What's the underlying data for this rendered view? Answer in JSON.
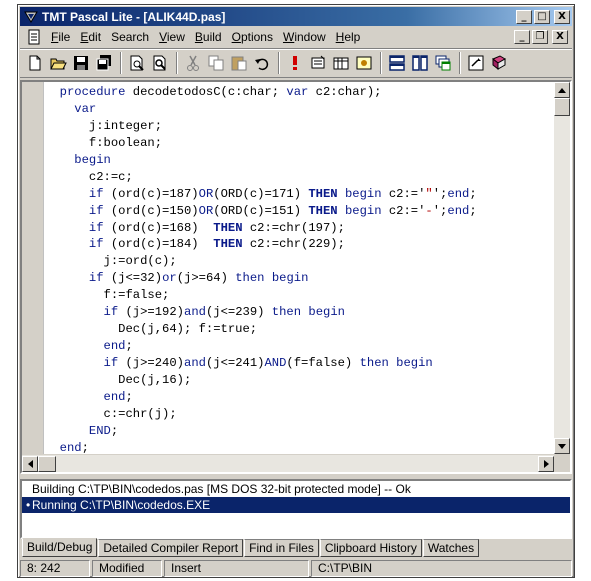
{
  "window": {
    "title": "TMT Pascal Lite - [ALIK44D.pas]",
    "controls": {
      "minimize": "_",
      "maximize": "□",
      "close": "X"
    }
  },
  "menubar": {
    "items": [
      {
        "label": "File",
        "accel": "F",
        "rest": "ile"
      },
      {
        "label": "Edit",
        "accel": "E",
        "rest": "dit"
      },
      {
        "label": "Search",
        "accel": "",
        "rest": "Search"
      },
      {
        "label": "View",
        "accel": "V",
        "rest": "iew"
      },
      {
        "label": "Build",
        "accel": "B",
        "rest": "uild"
      },
      {
        "label": "Options",
        "accel": "O",
        "rest": "ptions"
      },
      {
        "label": "Window",
        "accel": "W",
        "rest": "indow"
      },
      {
        "label": "Help",
        "accel": "H",
        "rest": "elp"
      }
    ],
    "mdi_controls": {
      "minimize": "_",
      "restore": "❐",
      "close": "X"
    }
  },
  "toolbar": {
    "buttons": [
      "new-file-icon",
      "open-folder-icon",
      "save-icon",
      "save-all-icon",
      "print-preview-icon",
      "find-icon",
      "cut-icon",
      "copy-icon",
      "paste-icon",
      "undo-icon",
      "run-icon",
      "compile-icon",
      "build-icon",
      "debug-icon",
      "tile-horizontal-icon",
      "tile-vertical-icon",
      "cascade-icon",
      "help-icon",
      "book-icon"
    ]
  },
  "editor": {
    "lines": [
      [
        [
          "kwp",
          "procedure"
        ],
        [
          "t",
          " decodetodosC(c:char; "
        ],
        [
          "kwp",
          "var"
        ],
        [
          "t",
          " c2:char);"
        ]
      ],
      [
        [
          "t",
          "  "
        ],
        [
          "kwp",
          "var"
        ]
      ],
      [
        [
          "t",
          "    j:integer;"
        ]
      ],
      [
        [
          "t",
          "    f:boolean;"
        ]
      ],
      [
        [
          "t",
          "  "
        ],
        [
          "kwp",
          "begin"
        ]
      ],
      [
        [
          "t",
          "    c2:=c;"
        ]
      ],
      [
        [
          "t",
          "    "
        ],
        [
          "kwp",
          "if"
        ],
        [
          "t",
          " (ord(c)=187)"
        ],
        [
          "kwp",
          "OR"
        ],
        [
          "t",
          "(ORD(c)=171) "
        ],
        [
          "kw",
          "THEN"
        ],
        [
          "t",
          " "
        ],
        [
          "kwp",
          "begin"
        ],
        [
          "t",
          " c2:='"
        ],
        [
          "str",
          "\""
        ],
        [
          "t",
          "';"
        ],
        [
          "kwp",
          "end"
        ],
        [
          "t",
          ";"
        ]
      ],
      [
        [
          "t",
          "    "
        ],
        [
          "kwp",
          "if"
        ],
        [
          "t",
          " (ord(c)=150)"
        ],
        [
          "kwp",
          "OR"
        ],
        [
          "t",
          "(ORD(c)=151) "
        ],
        [
          "kw",
          "THEN"
        ],
        [
          "t",
          " "
        ],
        [
          "kwp",
          "begin"
        ],
        [
          "t",
          " c2:='"
        ],
        [
          "str",
          "-"
        ],
        [
          "t",
          "';"
        ],
        [
          "kwp",
          "end"
        ],
        [
          "t",
          ";"
        ]
      ],
      [
        [
          "t",
          "    "
        ],
        [
          "kwp",
          "if"
        ],
        [
          "t",
          " (ord(c)=168)  "
        ],
        [
          "kw",
          "THEN"
        ],
        [
          "t",
          " c2:=chr(197);"
        ]
      ],
      [
        [
          "t",
          "    "
        ],
        [
          "kwp",
          "if"
        ],
        [
          "t",
          " (ord(c)=184)  "
        ],
        [
          "kw",
          "THEN"
        ],
        [
          "t",
          " c2:=chr(229);"
        ]
      ],
      [
        [
          "t",
          "      j:=ord(c);"
        ]
      ],
      [
        [
          "t",
          "    "
        ],
        [
          "kwp",
          "if"
        ],
        [
          "t",
          " (j<=32)"
        ],
        [
          "kwp",
          "or"
        ],
        [
          "t",
          "(j>=64) "
        ],
        [
          "kwp",
          "then"
        ],
        [
          "t",
          " "
        ],
        [
          "kwp",
          "begin"
        ]
      ],
      [
        [
          "t",
          "      f:=false;"
        ]
      ],
      [
        [
          "t",
          "      "
        ],
        [
          "kwp",
          "if"
        ],
        [
          "t",
          " (j>=192)"
        ],
        [
          "kwp",
          "and"
        ],
        [
          "t",
          "(j<=239) "
        ],
        [
          "kwp",
          "then"
        ],
        [
          "t",
          " "
        ],
        [
          "kwp",
          "begin"
        ]
      ],
      [
        [
          "t",
          "        Dec(j,64); f:=true;"
        ]
      ],
      [
        [
          "t",
          "      "
        ],
        [
          "kwp",
          "end"
        ],
        [
          "t",
          ";"
        ]
      ],
      [
        [
          "t",
          "      "
        ],
        [
          "kwp",
          "if"
        ],
        [
          "t",
          " (j>=240)"
        ],
        [
          "kwp",
          "and"
        ],
        [
          "t",
          "(j<=241)"
        ],
        [
          "kwp",
          "AND"
        ],
        [
          "t",
          "(f=false) "
        ],
        [
          "kwp",
          "then"
        ],
        [
          "t",
          " "
        ],
        [
          "kwp",
          "begin"
        ]
      ],
      [
        [
          "t",
          "        Dec(j,16);"
        ]
      ],
      [
        [
          "t",
          "      "
        ],
        [
          "kwp",
          "end"
        ],
        [
          "t",
          ";"
        ]
      ],
      [
        [
          "t",
          "      c:=chr(j);"
        ]
      ],
      [
        [
          "t",
          "    "
        ],
        [
          "kwp",
          "END"
        ],
        [
          "t",
          ";"
        ]
      ],
      [
        [
          "kwp",
          "end"
        ],
        [
          "t",
          ";"
        ]
      ]
    ]
  },
  "output": {
    "lines": [
      "Building C:\\TP\\BIN\\codedos.pas  [MS DOS 32-bit protected mode] -- Ok",
      "Running C:\\TP\\BIN\\codedos.EXE"
    ],
    "selected_prefix": "•"
  },
  "tabs": [
    "Build/Debug",
    "Detailed Compiler Report",
    "Find in Files",
    "Clipboard History",
    "Watches"
  ],
  "statusbar": {
    "position": "8: 242",
    "modified": "Modified",
    "mode": "Insert",
    "path": "C:\\TP\\BIN"
  }
}
